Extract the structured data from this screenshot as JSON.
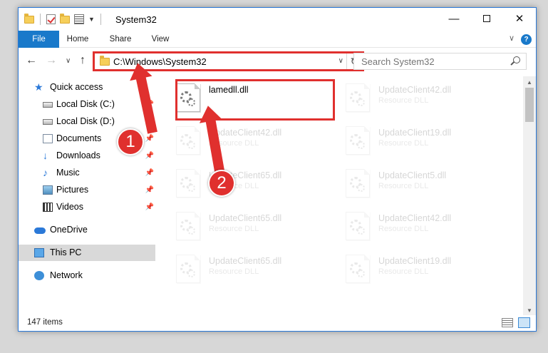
{
  "window": {
    "title": "System32"
  },
  "ribbon": {
    "tabs": [
      "File",
      "Home",
      "Share",
      "View"
    ],
    "help_glyph": "?"
  },
  "nav": {
    "address": "C:\\Windows\\System32",
    "search_placeholder": "Search System32"
  },
  "sidebar": {
    "items": [
      {
        "label": "Quick access",
        "icon": "star-icon"
      },
      {
        "label": "Local Disk (C:)",
        "icon": "drive-icon",
        "pinned": true
      },
      {
        "label": "Local Disk (D:)",
        "icon": "drive-icon",
        "pinned": true
      },
      {
        "label": "Documents",
        "icon": "documents-icon",
        "pinned": true
      },
      {
        "label": "Downloads",
        "icon": "downloads-icon",
        "pinned": true
      },
      {
        "label": "Music",
        "icon": "music-icon",
        "pinned": true
      },
      {
        "label": "Pictures",
        "icon": "pictures-icon",
        "pinned": true
      },
      {
        "label": "Videos",
        "icon": "videos-icon",
        "pinned": true
      },
      {
        "label": "OneDrive",
        "icon": "onedrive-icon"
      },
      {
        "label": "This PC",
        "icon": "pc-icon",
        "selected": true
      },
      {
        "label": "Network",
        "icon": "network-icon"
      }
    ]
  },
  "files": [
    {
      "name": "lamedll.dll",
      "type": "",
      "highlighted": true
    },
    {
      "name": "UpdateClient42.dll",
      "type": "Resource DLL"
    },
    {
      "name": "UpdateClient42.dll",
      "type": "Resource DLL"
    },
    {
      "name": "UpdateClient19.dll",
      "type": "Resource DLL"
    },
    {
      "name": "UpdateClient65.dll",
      "type": "Resource DLL"
    },
    {
      "name": "UpdateClient5.dll",
      "type": "Resource DLL"
    },
    {
      "name": "UpdateClient65.dll",
      "type": "Resource DLL"
    },
    {
      "name": "UpdateClient42.dll",
      "type": "Resource DLL"
    },
    {
      "name": "UpdateClient65.dll",
      "type": "Resource DLL"
    },
    {
      "name": "UpdateClient19.dll",
      "type": "Resource DLL"
    }
  ],
  "status": {
    "item_count": "147 items"
  },
  "annotations": {
    "step1": "1",
    "step2": "2",
    "color": "#e0302e"
  }
}
